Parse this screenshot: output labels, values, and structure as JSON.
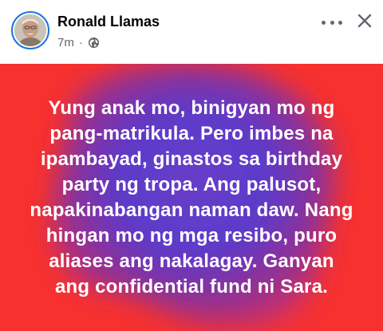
{
  "post": {
    "author": "Ronald Llamas",
    "timestamp": "7m",
    "separator": "·",
    "audience_icon": "globe-icon",
    "body_lines": [
      "Yung anak mo, binigyan mo ng",
      "pang-matrikula. Pero imbes na",
      "ipambayad, ginastos sa birthday",
      "party ng tropa. Ang palusot,",
      "napakinabangan naman daw. Nang",
      "hingan mo ng mga resibo, puro",
      "aliases ang nakalagay. Ganyan",
      "ang confidential fund ni Sara."
    ],
    "background_colors": {
      "base": "#f7312e",
      "blob_inner": "#5b3fd0",
      "blob_outer": "#b12f78"
    }
  },
  "header_actions": {
    "more_icon": "more-horizontal-icon",
    "close_icon": "close-icon"
  }
}
